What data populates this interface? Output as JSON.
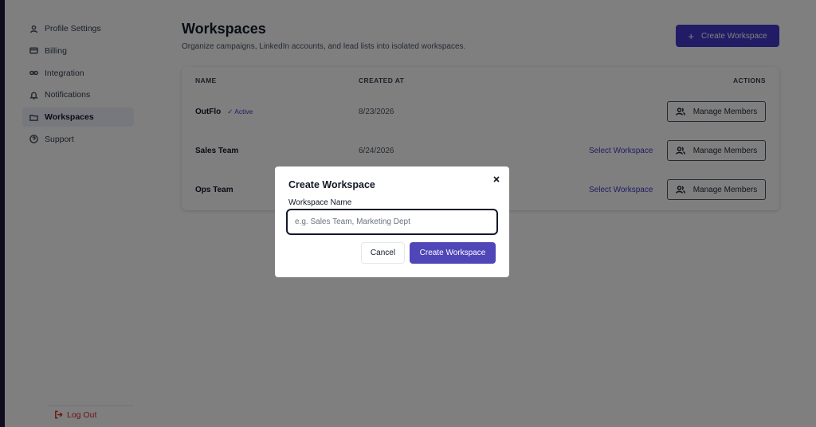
{
  "sidebar": {
    "items": [
      {
        "label": "Profile Settings",
        "icon": "user-icon",
        "active": false
      },
      {
        "label": "Billing",
        "icon": "credit-card-icon",
        "active": false
      },
      {
        "label": "Integration",
        "icon": "link-icon",
        "active": false
      },
      {
        "label": "Notifications",
        "icon": "bell-icon",
        "active": false
      },
      {
        "label": "Workspaces",
        "icon": "folder-icon",
        "active": true
      },
      {
        "label": "Support",
        "icon": "help-circle-icon",
        "active": false
      }
    ],
    "logout_label": "Log Out"
  },
  "header": {
    "title": "Workspaces",
    "subtitle": "Organize campaigns, LinkedIn accounts, and lead lists into isolated workspaces.",
    "create_button_label": "Create Workspace"
  },
  "table": {
    "columns": [
      "NAME",
      "CREATED AT",
      "ACTIONS"
    ],
    "rows": [
      {
        "name": "OutFlo",
        "badge": "✓ Active",
        "created_at": "8/23/2026",
        "select_label": "",
        "manage_label": "Manage Members"
      },
      {
        "name": "Sales Team",
        "badge": "",
        "created_at": "6/24/2026",
        "select_label": "Select Workspace",
        "manage_label": "Manage Members"
      },
      {
        "name": "Ops Team",
        "badge": "",
        "created_at": "",
        "select_label": "Select Workspace",
        "manage_label": "Manage Members"
      }
    ]
  },
  "modal": {
    "title": "Create Workspace",
    "field_label": "Workspace Name",
    "field_value": "",
    "field_placeholder": "e.g. Sales Team, Marketing Dept",
    "cancel_label": "Cancel",
    "submit_label": "Create Workspace"
  },
  "colors": {
    "accent": "#4338ca",
    "danger": "#dc2626",
    "overlay": "rgba(0,0,0,0.5)"
  }
}
